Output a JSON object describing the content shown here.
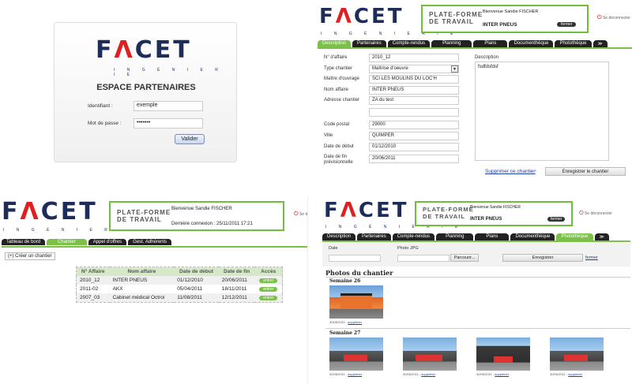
{
  "brand": {
    "logo_left": "F",
    "logo_mid": "Λ",
    "logo_right": "CET",
    "subtitle": "I N G É N I E R I E"
  },
  "login": {
    "title": "ESPACE PARTENAIRES",
    "id_label": "Identifiant :",
    "id_value": "exemple",
    "pw_label": "Mot de passe :",
    "pw_value": "•••••••",
    "submit": "Valider"
  },
  "platform": {
    "title1": "PLATE-FORME",
    "title2": "DE TRAVAIL",
    "welcome": "Bienvenue Sandie FISCHER",
    "last_login": "Dernière connexion : 25/11/2011 17:21",
    "logout": "Se déconnecter",
    "partner": "INTER PNEUS",
    "close": "fermer"
  },
  "tr": {
    "tabs": [
      "Description",
      "Partenaires",
      "Compte-rendus",
      "Planning",
      "Plans",
      "Documenthèque",
      "Photothèque"
    ],
    "more": "≫",
    "fields": [
      {
        "label": "N° d'affaire",
        "value": "2010_12"
      },
      {
        "label": "Type chantier",
        "value": "Maîtrise d'oeuvre"
      },
      {
        "label": "Maître d'ouvrage",
        "value": "SCI LES MOULINS DU LOC'H"
      },
      {
        "label": "Nom affaire",
        "value": "INTER PNEUS"
      },
      {
        "label": "Adresse chantier",
        "value": "ZA du test"
      },
      {
        "label": "",
        "value": ""
      },
      {
        "label": "Code postal",
        "value": "29000"
      },
      {
        "label": "Ville",
        "value": "QUIMPER"
      },
      {
        "label": "Date de début",
        "value": "01/12/2010"
      },
      {
        "label": "Date de fin prévisionnelle",
        "value": "20/06/2011"
      }
    ],
    "desc_label": "Description",
    "desc_value": "fsdfdsfdsf",
    "delete": "Supprimer ce chantier",
    "save": "Enregistrer le chantier"
  },
  "bl": {
    "tabs": [
      "Tableau de bord",
      "Chantier",
      "Appel d'offres",
      "Gest. Adhérents"
    ],
    "create": "(+) Créer un chantier",
    "headers": [
      "N° Affaire",
      "Nom affaire",
      "Date de début",
      "Date de fin",
      "Accès"
    ],
    "rows": [
      {
        "n": "2010_12",
        "nom": "INTER PNEUS",
        "deb": "01/12/2010",
        "fin": "20/06/2011",
        "acces": "entrer"
      },
      {
        "n": "2011-02",
        "nom": "AKX",
        "deb": "05/04/2011",
        "fin": "18/11/2011",
        "acces": "entrer"
      },
      {
        "n": "2007_03",
        "nom": "Cabinet médical Octroi",
        "deb": "11/08/2011",
        "fin": "12/12/2011",
        "acces": "entrer"
      }
    ]
  },
  "br": {
    "date_label": "Date",
    "photo_label": "Photo JPG",
    "browse": "Parcourir...",
    "save": "Enregistrer",
    "close": "fermer",
    "section": "Photos du chantier",
    "week1": "Semaine 26",
    "week2": "Semaine 27",
    "caption_date": "30/06/2011 - ",
    "caption_link": "supprimer"
  }
}
